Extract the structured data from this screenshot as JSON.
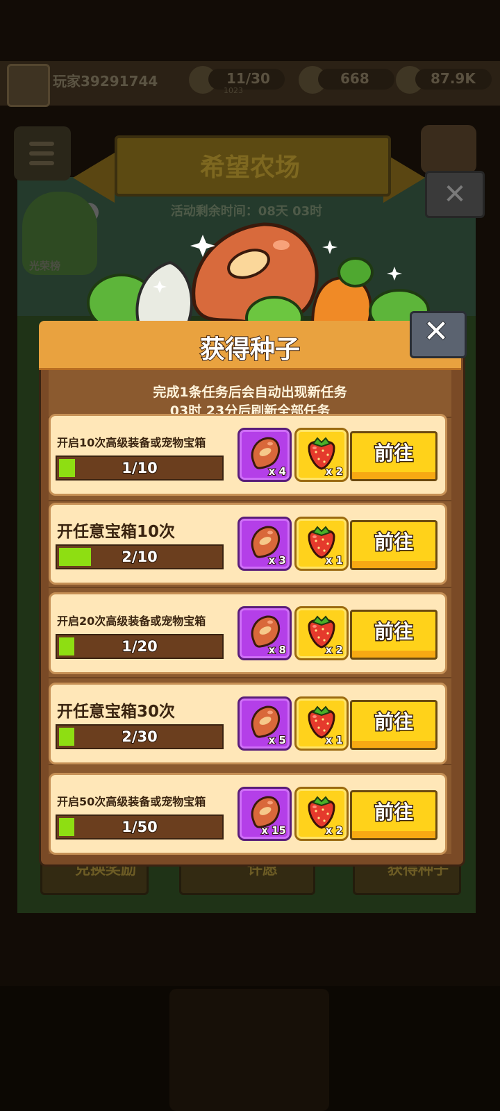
{
  "background": {
    "player_name": "玩家39291744",
    "resources": [
      {
        "icon": "tree-icon",
        "value": "11/30",
        "sub": "1023"
      },
      {
        "icon": "leaf-icon",
        "value": "668"
      },
      {
        "icon": "sprout-icon",
        "value": "87.9K"
      }
    ],
    "banner_title": "希望农场",
    "timer": "活动剩余时间：08天 03时",
    "honor_label": "光荣榜",
    "bottom_buttons": [
      "兑换奖励",
      "许愿",
      "获得种子"
    ]
  },
  "modal": {
    "title": "获得种子",
    "subtitle_line1": "完成1条任务后会自动出现新任务",
    "subtitle_line2": "03时 23分后刷新全部任务",
    "close_icon": "close-icon",
    "tasks": [
      {
        "name": "开启10次高级装备或宠物宝箱",
        "progress_text": "1/10",
        "progress": 0.1,
        "seed_qty": "x 4",
        "berry_qty": "x 2",
        "button": "前往",
        "size": "small"
      },
      {
        "name": "开任意宝箱10次",
        "progress_text": "2/10",
        "progress": 0.2,
        "seed_qty": "x 3",
        "berry_qty": "x 1",
        "button": "前往",
        "size": "big"
      },
      {
        "name": "开启20次高级装备或宠物宝箱",
        "progress_text": "1/20",
        "progress": 0.05,
        "seed_qty": "x 8",
        "berry_qty": "x 2",
        "button": "前往",
        "size": "small"
      },
      {
        "name": "开任意宝箱30次",
        "progress_text": "2/30",
        "progress": 0.067,
        "seed_qty": "x 5",
        "berry_qty": "x 1",
        "button": "前往",
        "size": "big"
      },
      {
        "name": "开启50次高级装备或宠物宝箱",
        "progress_text": "1/50",
        "progress": 0.02,
        "seed_qty": "x 15",
        "berry_qty": "x 2",
        "button": "前往",
        "size": "small"
      }
    ]
  },
  "colors": {
    "header_orange": "#e9a23f",
    "card_cream": "#ffe7b8",
    "progress_green": "#8ede12",
    "reward_purple": "#b43fe8",
    "reward_gold": "#ffd21c",
    "button_yellow": "#ffd21a"
  }
}
